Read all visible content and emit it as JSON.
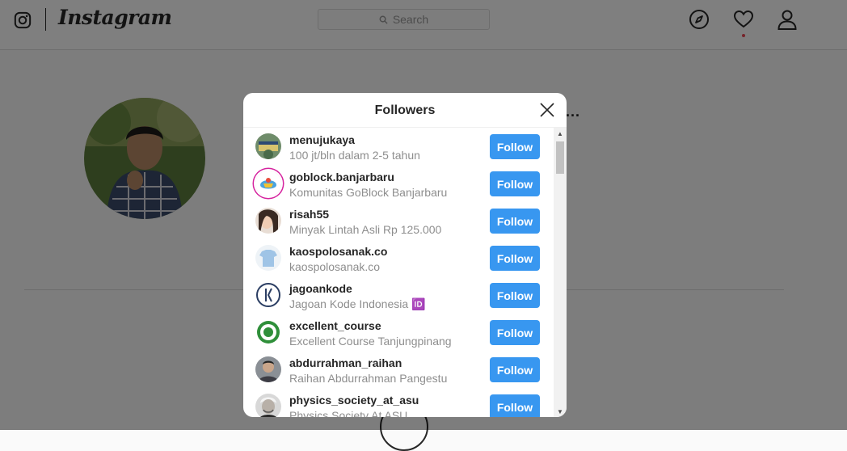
{
  "nav": {
    "brand": "Instagram",
    "search_placeholder": "Search",
    "icons": [
      "instagram-glyph-icon",
      "compass-icon",
      "heart-icon",
      "profile-icon"
    ],
    "notification_dot_color": "#ed4956"
  },
  "profile": {
    "more_label": "..."
  },
  "modal": {
    "title": "Followers",
    "follow_button_color": "#3897f0",
    "followers": [
      {
        "username": "menujukaya",
        "fullname": "100 jt/bln dalam 2-5 tahun",
        "button": "Follow"
      },
      {
        "username": "goblock.banjarbaru",
        "fullname": "Komunitas GoBlock Banjarbaru",
        "button": "Follow"
      },
      {
        "username": "risah55",
        "fullname": "Minyak Lintah Asli Rp 125.000",
        "button": "Follow"
      },
      {
        "username": "kaospolosanak.co",
        "fullname": "kaospolosanak.co",
        "button": "Follow"
      },
      {
        "username": "jagoankode",
        "fullname": "Jagoan Kode Indonesia 🆔",
        "button": "Follow"
      },
      {
        "username": "excellent_course",
        "fullname": "Excellent Course Tanjungpinang",
        "button": "Follow"
      },
      {
        "username": "abdurrahman_raihan",
        "fullname": "Raihan Abdurrahman Pangestu",
        "button": "Follow"
      },
      {
        "username": "physics_society_at_asu",
        "fullname": "Physics Society At ASU",
        "button": "Follow"
      }
    ]
  }
}
